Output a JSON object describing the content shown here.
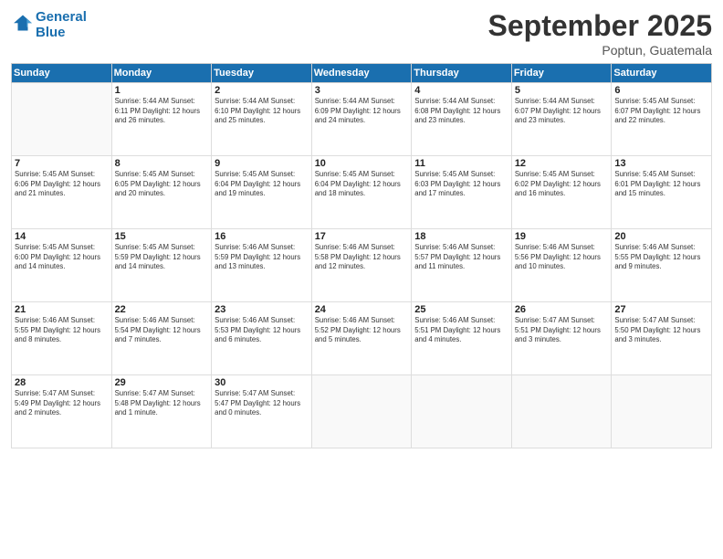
{
  "logo": {
    "line1": "General",
    "line2": "Blue"
  },
  "title": "September 2025",
  "location": "Poptun, Guatemala",
  "days_header": [
    "Sunday",
    "Monday",
    "Tuesday",
    "Wednesday",
    "Thursday",
    "Friday",
    "Saturday"
  ],
  "weeks": [
    [
      {
        "day": "",
        "text": ""
      },
      {
        "day": "1",
        "text": "Sunrise: 5:44 AM\nSunset: 6:11 PM\nDaylight: 12 hours\nand 26 minutes."
      },
      {
        "day": "2",
        "text": "Sunrise: 5:44 AM\nSunset: 6:10 PM\nDaylight: 12 hours\nand 25 minutes."
      },
      {
        "day": "3",
        "text": "Sunrise: 5:44 AM\nSunset: 6:09 PM\nDaylight: 12 hours\nand 24 minutes."
      },
      {
        "day": "4",
        "text": "Sunrise: 5:44 AM\nSunset: 6:08 PM\nDaylight: 12 hours\nand 23 minutes."
      },
      {
        "day": "5",
        "text": "Sunrise: 5:44 AM\nSunset: 6:07 PM\nDaylight: 12 hours\nand 23 minutes."
      },
      {
        "day": "6",
        "text": "Sunrise: 5:45 AM\nSunset: 6:07 PM\nDaylight: 12 hours\nand 22 minutes."
      }
    ],
    [
      {
        "day": "7",
        "text": "Sunrise: 5:45 AM\nSunset: 6:06 PM\nDaylight: 12 hours\nand 21 minutes."
      },
      {
        "day": "8",
        "text": "Sunrise: 5:45 AM\nSunset: 6:05 PM\nDaylight: 12 hours\nand 20 minutes."
      },
      {
        "day": "9",
        "text": "Sunrise: 5:45 AM\nSunset: 6:04 PM\nDaylight: 12 hours\nand 19 minutes."
      },
      {
        "day": "10",
        "text": "Sunrise: 5:45 AM\nSunset: 6:04 PM\nDaylight: 12 hours\nand 18 minutes."
      },
      {
        "day": "11",
        "text": "Sunrise: 5:45 AM\nSunset: 6:03 PM\nDaylight: 12 hours\nand 17 minutes."
      },
      {
        "day": "12",
        "text": "Sunrise: 5:45 AM\nSunset: 6:02 PM\nDaylight: 12 hours\nand 16 minutes."
      },
      {
        "day": "13",
        "text": "Sunrise: 5:45 AM\nSunset: 6:01 PM\nDaylight: 12 hours\nand 15 minutes."
      }
    ],
    [
      {
        "day": "14",
        "text": "Sunrise: 5:45 AM\nSunset: 6:00 PM\nDaylight: 12 hours\nand 14 minutes."
      },
      {
        "day": "15",
        "text": "Sunrise: 5:45 AM\nSunset: 5:59 PM\nDaylight: 12 hours\nand 14 minutes."
      },
      {
        "day": "16",
        "text": "Sunrise: 5:46 AM\nSunset: 5:59 PM\nDaylight: 12 hours\nand 13 minutes."
      },
      {
        "day": "17",
        "text": "Sunrise: 5:46 AM\nSunset: 5:58 PM\nDaylight: 12 hours\nand 12 minutes."
      },
      {
        "day": "18",
        "text": "Sunrise: 5:46 AM\nSunset: 5:57 PM\nDaylight: 12 hours\nand 11 minutes."
      },
      {
        "day": "19",
        "text": "Sunrise: 5:46 AM\nSunset: 5:56 PM\nDaylight: 12 hours\nand 10 minutes."
      },
      {
        "day": "20",
        "text": "Sunrise: 5:46 AM\nSunset: 5:55 PM\nDaylight: 12 hours\nand 9 minutes."
      }
    ],
    [
      {
        "day": "21",
        "text": "Sunrise: 5:46 AM\nSunset: 5:55 PM\nDaylight: 12 hours\nand 8 minutes."
      },
      {
        "day": "22",
        "text": "Sunrise: 5:46 AM\nSunset: 5:54 PM\nDaylight: 12 hours\nand 7 minutes."
      },
      {
        "day": "23",
        "text": "Sunrise: 5:46 AM\nSunset: 5:53 PM\nDaylight: 12 hours\nand 6 minutes."
      },
      {
        "day": "24",
        "text": "Sunrise: 5:46 AM\nSunset: 5:52 PM\nDaylight: 12 hours\nand 5 minutes."
      },
      {
        "day": "25",
        "text": "Sunrise: 5:46 AM\nSunset: 5:51 PM\nDaylight: 12 hours\nand 4 minutes."
      },
      {
        "day": "26",
        "text": "Sunrise: 5:47 AM\nSunset: 5:51 PM\nDaylight: 12 hours\nand 3 minutes."
      },
      {
        "day": "27",
        "text": "Sunrise: 5:47 AM\nSunset: 5:50 PM\nDaylight: 12 hours\nand 3 minutes."
      }
    ],
    [
      {
        "day": "28",
        "text": "Sunrise: 5:47 AM\nSunset: 5:49 PM\nDaylight: 12 hours\nand 2 minutes."
      },
      {
        "day": "29",
        "text": "Sunrise: 5:47 AM\nSunset: 5:48 PM\nDaylight: 12 hours\nand 1 minute."
      },
      {
        "day": "30",
        "text": "Sunrise: 5:47 AM\nSunset: 5:47 PM\nDaylight: 12 hours\nand 0 minutes."
      },
      {
        "day": "",
        "text": ""
      },
      {
        "day": "",
        "text": ""
      },
      {
        "day": "",
        "text": ""
      },
      {
        "day": "",
        "text": ""
      }
    ]
  ]
}
